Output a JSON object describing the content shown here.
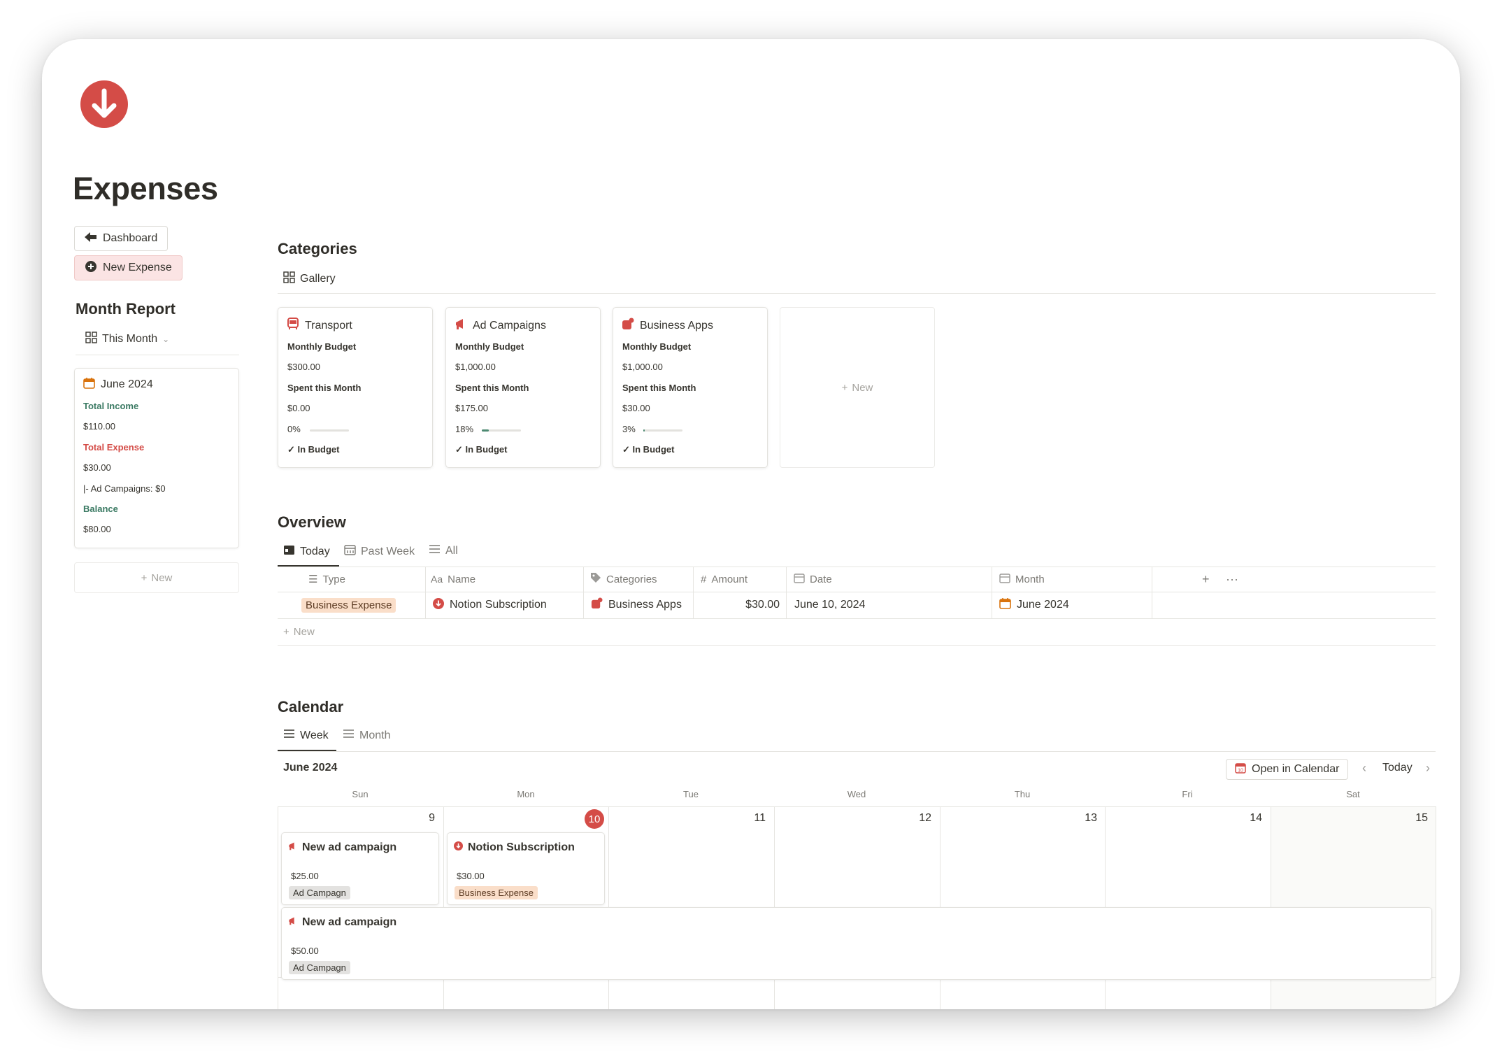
{
  "page": {
    "title": "Expenses",
    "icon": "arrow-down-circle-icon"
  },
  "buttons": {
    "dashboard": "Dashboard",
    "new_expense": "New Expense"
  },
  "month_report": {
    "title": "Month Report",
    "view": "This Month",
    "card": {
      "month": "June 2024",
      "total_income_label": "Total Income",
      "total_income": "$110.00",
      "total_expense_label": "Total Expense",
      "total_expense": "$30.00",
      "ad_campaigns_line": "|- Ad Campaigns: $0",
      "balance_label": "Balance",
      "balance": "$80.00"
    },
    "new_label": "New"
  },
  "categories": {
    "title": "Categories",
    "view": "Gallery",
    "budget_label": "Monthly Budget",
    "spent_label": "Spent this Month",
    "cards": [
      {
        "name": "Transport",
        "icon": "bus-icon",
        "budget": "$300.00",
        "spent": "$0.00",
        "percent_label": "0%",
        "percent": 0,
        "status": "In Budget"
      },
      {
        "name": "Ad Campaigns",
        "icon": "megaphone-icon",
        "budget": "$1,000.00",
        "spent": "$175.00",
        "percent_label": "18%",
        "percent": 0.18,
        "status": "In Budget"
      },
      {
        "name": "Business Apps",
        "icon": "apps-icon",
        "budget": "$1,000.00",
        "spent": "$30.00",
        "percent_label": "3%",
        "percent": 0.03,
        "status": "In Budget"
      }
    ],
    "new_label": "New"
  },
  "overview": {
    "title": "Overview",
    "tabs": [
      "Today",
      "Past Week",
      "All"
    ],
    "columns": {
      "type": "Type",
      "name": "Name",
      "categories": "Categories",
      "amount": "Amount",
      "date": "Date",
      "month": "Month"
    },
    "rows": [
      {
        "type": "Business Expense",
        "name": "Notion Subscription",
        "category": "Business Apps",
        "amount": "$30.00",
        "date": "June 10, 2024",
        "month": "June 2024"
      }
    ],
    "new_label": "New"
  },
  "calendar": {
    "title": "Calendar",
    "tabs": [
      "Week",
      "Month"
    ],
    "period": "June 2024",
    "open_in_calendar": "Open in Calendar",
    "today_label": "Today",
    "weekdays": [
      "Sun",
      "Mon",
      "Tue",
      "Wed",
      "Thu",
      "Fri",
      "Sat"
    ],
    "days": [
      "9",
      "10",
      "11",
      "12",
      "13",
      "14",
      "15"
    ],
    "today_day": "10",
    "events": [
      {
        "title": "New ad campaign",
        "amount": "$25.00",
        "tag": "Ad Campagn"
      },
      {
        "title": "Notion Subscription",
        "amount": "$30.00",
        "tag": "Business Expense"
      },
      {
        "title": "New ad campaign",
        "amount": "$50.00",
        "tag": "Ad Campagn"
      }
    ]
  },
  "colors": {
    "accent_red": "#d44c47",
    "green": "#3b7a63",
    "orange_tag": "#fadec9",
    "gray_tag": "#e3e2e0"
  }
}
